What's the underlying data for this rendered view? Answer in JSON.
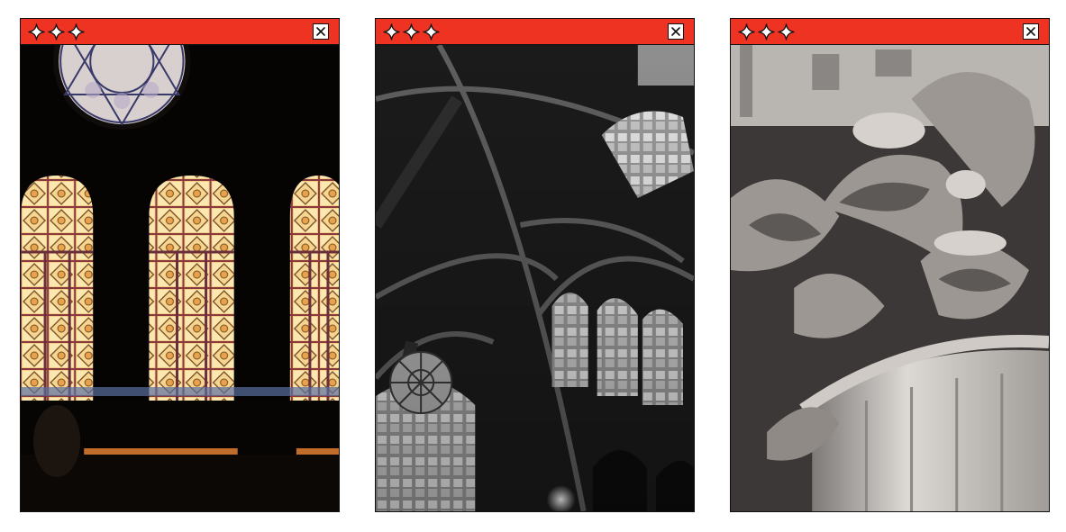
{
  "theme": {
    "titlebar_color": "#ef3323",
    "border_color": "#111111",
    "background": "#ffffff"
  },
  "windows": [
    {
      "icons": [
        "sparkle-icon",
        "sparkle-icon",
        "sparkle-icon"
      ],
      "close_icon": "close-icon"
    },
    {
      "icons": [
        "sparkle-icon",
        "sparkle-icon",
        "sparkle-icon"
      ],
      "close_icon": "close-icon"
    },
    {
      "icons": [
        "sparkle-icon",
        "sparkle-icon",
        "sparkle-icon"
      ],
      "close_icon": "close-icon"
    }
  ]
}
